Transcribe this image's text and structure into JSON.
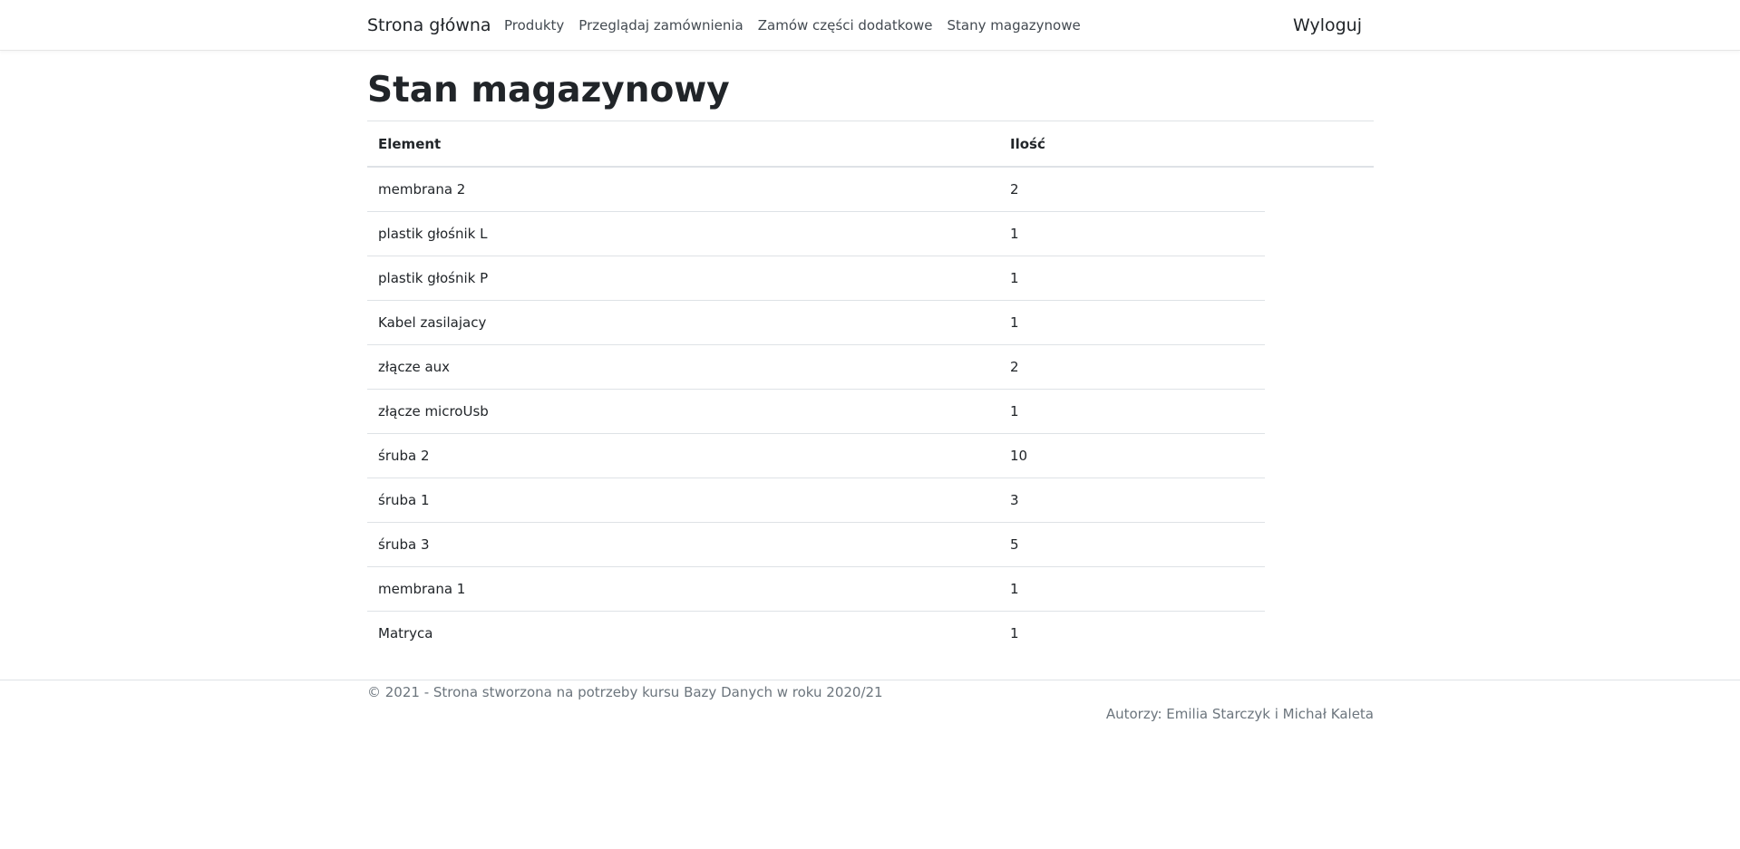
{
  "navbar": {
    "brand": "Strona główna",
    "links": [
      "Produkty",
      "Przeglądaj zamównienia",
      "Zamów części dodatkowe",
      "Stany magazynowe"
    ],
    "logout": "Wyloguj"
  },
  "main": {
    "title": "Stan magazynowy",
    "table": {
      "headers": [
        "Element",
        "Ilość"
      ],
      "rows": [
        [
          "membrana 2",
          "2"
        ],
        [
          "plastik głośnik L",
          "1"
        ],
        [
          "plastik głośnik P",
          "1"
        ],
        [
          "Kabel zasilajacy",
          "1"
        ],
        [
          "złącze aux",
          "2"
        ],
        [
          "złącze microUsb",
          "1"
        ],
        [
          "śruba 2",
          "10"
        ],
        [
          "śruba 1",
          "3"
        ],
        [
          "śruba 3",
          "5"
        ],
        [
          "membrana 1",
          "1"
        ],
        [
          "Matryca",
          "1"
        ]
      ]
    }
  },
  "footer": {
    "copyright": "© 2021 - Strona stworzona na potrzeby kursu Bazy Danych w roku 2020/21",
    "authors": "Autorzy: Emilia Starczyk i Michał Kaleta"
  }
}
